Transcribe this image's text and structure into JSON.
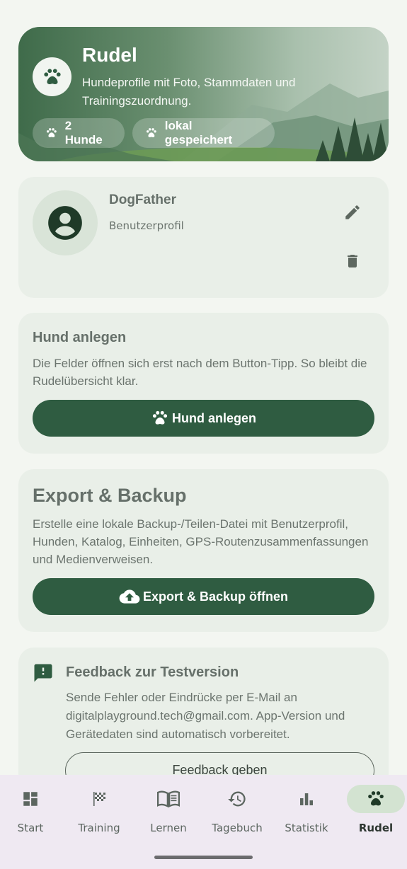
{
  "hero": {
    "title": "Rudel",
    "subtitle": "Hundeprofile mit Foto, Stammdaten und Trainingszuordnung.",
    "chip_dogs": "2 Hunde",
    "chip_storage": "lokal gespeichert"
  },
  "profile": {
    "name": "DogFather",
    "role": "Benutzerprofil"
  },
  "dog_card": {
    "title": "Hund anlegen",
    "text": "Die Felder öffnen sich erst nach dem Button-Tipp. So bleibt die Rudelübersicht klar.",
    "button": "Hund anlegen"
  },
  "export_card": {
    "title": "Export & Backup",
    "text": "Erstelle eine lokale Backup-/Teilen-Datei mit Benutzerprofil, Hunden, Katalog, Einheiten, GPS-Routenzusammenfassungen und Medienverweisen.",
    "button": "Export & Backup öffnen"
  },
  "feedback_card": {
    "title": "Feedback zur Testversion",
    "text": "Sende Fehler oder Eindrücke per E-Mail an digitalplayground.tech@gmail.com. App-Version und Gerätedaten sind automatisch vorbereitet.",
    "button": "Feedback geben"
  },
  "nav": {
    "items": [
      {
        "label": "Start",
        "icon": "dashboard-icon"
      },
      {
        "label": "Training",
        "icon": "checkered-flag-icon"
      },
      {
        "label": "Lernen",
        "icon": "book-icon"
      },
      {
        "label": "Tagebuch",
        "icon": "history-icon"
      },
      {
        "label": "Statistik",
        "icon": "bar-chart-icon"
      },
      {
        "label": "Rudel",
        "icon": "paw-icon"
      }
    ],
    "active": "Rudel"
  },
  "colors": {
    "primary": "#2f5c41",
    "background": "#f3f6f1",
    "card": "#e9efe8",
    "nav_background": "#efe9f2",
    "nav_active": "#d3e3d1"
  }
}
